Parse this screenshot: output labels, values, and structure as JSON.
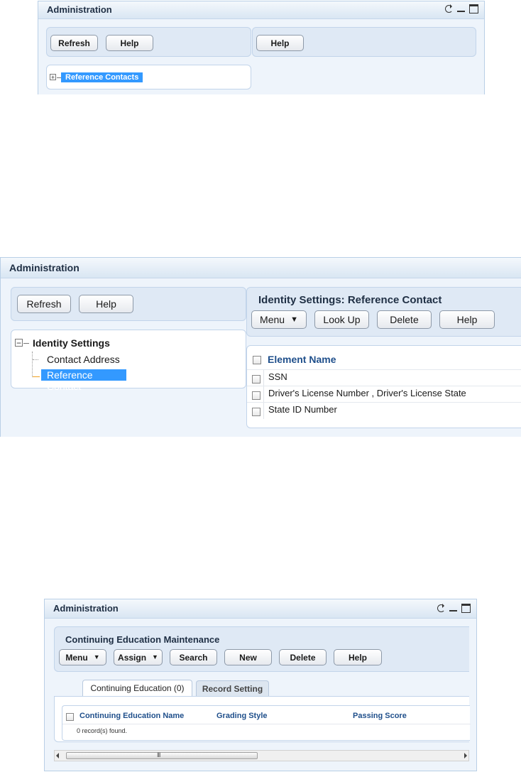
{
  "panel1": {
    "title": "Administration",
    "toolbar_left": {
      "refresh_label": "Refresh",
      "help_label": "Help"
    },
    "toolbar_right": {
      "help_label": "Help"
    },
    "tree": {
      "toggle": "+",
      "item_label": "Reference Contacts"
    }
  },
  "panel2": {
    "title": "Administration",
    "toolbar_left": {
      "refresh_label": "Refresh",
      "help_label": "Help"
    },
    "tree": {
      "toggle": "−",
      "root_label": "Identity Settings",
      "children": [
        {
          "label": "Contact Address"
        },
        {
          "label": "Reference Contact"
        }
      ]
    },
    "detail": {
      "title": "Identity Settings: Reference Contact",
      "buttons": {
        "menu": "Menu",
        "lookup": "Look Up",
        "delete": "Delete",
        "help": "Help"
      },
      "table": {
        "header": "Element Name",
        "rows": [
          {
            "name": "SSN"
          },
          {
            "name": "Driver's License Number , Driver's License State"
          },
          {
            "name": "State ID Number"
          }
        ]
      }
    }
  },
  "panel3": {
    "title": "Administration",
    "section_title": "Continuing Education Maintenance",
    "buttons": {
      "menu": "Menu",
      "assign": "Assign",
      "search": "Search",
      "new": "New",
      "delete": "Delete",
      "help": "Help"
    },
    "tabs": [
      {
        "label": "Continuing Education (0)",
        "active": true
      },
      {
        "label": "Record Setting",
        "active": false
      }
    ],
    "table": {
      "columns": [
        "Continuing Education Name",
        "Grading Style",
        "Passing Score"
      ],
      "empty_message": "0 record(s) found."
    },
    "scrollbar": {
      "grip": "III"
    }
  },
  "icons": {
    "caret": "▼"
  }
}
